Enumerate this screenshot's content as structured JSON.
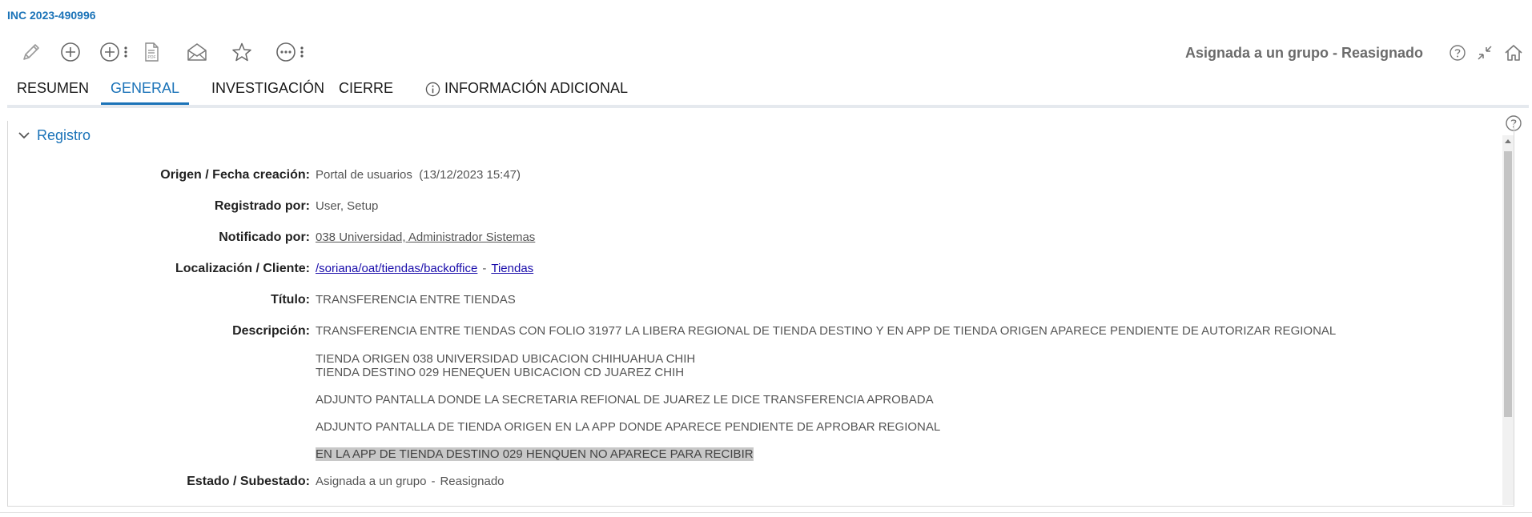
{
  "header": {
    "incident_id": "INC 2023-490996",
    "status": "Asignada a un grupo - Reasignado"
  },
  "toolbar": {
    "icons": [
      "pencil-icon",
      "plus-circle-icon",
      "plus-circle-menu-icon",
      "pdf-icon",
      "envelope-open-icon",
      "star-icon",
      "more-options-icon"
    ]
  },
  "tabs": [
    {
      "label": "RESUMEN",
      "active": false
    },
    {
      "label": "GENERAL",
      "active": true
    },
    {
      "label": "INVESTIGACIÓN",
      "active": false
    },
    {
      "label": "CIERRE",
      "active": false
    },
    {
      "label": "INFORMACIÓN ADICIONAL",
      "active": false,
      "icon": "info-icon"
    }
  ],
  "section": {
    "title": "Registro"
  },
  "fields": {
    "origen": {
      "label": "Origen / Fecha creación:",
      "value": "Portal de usuarios",
      "date": "(13/12/2023 15:47)"
    },
    "registrado": {
      "label": "Registrado por:",
      "value": "User, Setup"
    },
    "notificado": {
      "label": "Notificado por:",
      "value": "038 Universidad, Administrador Sistemas"
    },
    "localizacion": {
      "label": "Localización / Cliente:",
      "location": "/soriana/oat/tiendas/backoffice",
      "separator": "-",
      "client": "Tiendas"
    },
    "titulo": {
      "label": "Título:",
      "value": "TRANSFERENCIA ENTRE TIENDAS"
    },
    "descripcion": {
      "label": "Descripción:",
      "lines": [
        "TRANSFERENCIA ENTRE TIENDAS CON FOLIO 31977 LA LIBERA REGIONAL DE TIENDA DESTINO Y EN APP DE TIENDA ORIGEN APARECE PENDIENTE DE AUTORIZAR REGIONAL",
        "TIENDA ORIGEN 038 UNIVERSIDAD UBICACION CHIHUAHUA CHIH",
        "TIENDA DESTINO 029 HENEQUEN UBICACION CD JUAREZ CHIH",
        "ADJUNTO PANTALLA DONDE LA SECRETARIA REFIONAL DE JUAREZ LE DICE TRANSFERENCIA APROBADA",
        "ADJUNTO PANTALLA DE TIENDA ORIGEN EN LA APP DONDE APARECE PENDIENTE DE APROBAR REGIONAL",
        "EN LA APP DE TIENDA DESTINO 029 HENQUEN NO APARECE PARA RECIBIR"
      ]
    },
    "estado": {
      "label": "Estado / Subestado:",
      "state": "Asignada a un grupo",
      "separator": "-",
      "substate": "Reasignado"
    }
  },
  "colors": {
    "accent": "#1b73b8",
    "link": "#1a0dab",
    "highlight": "#c8c8c8"
  }
}
